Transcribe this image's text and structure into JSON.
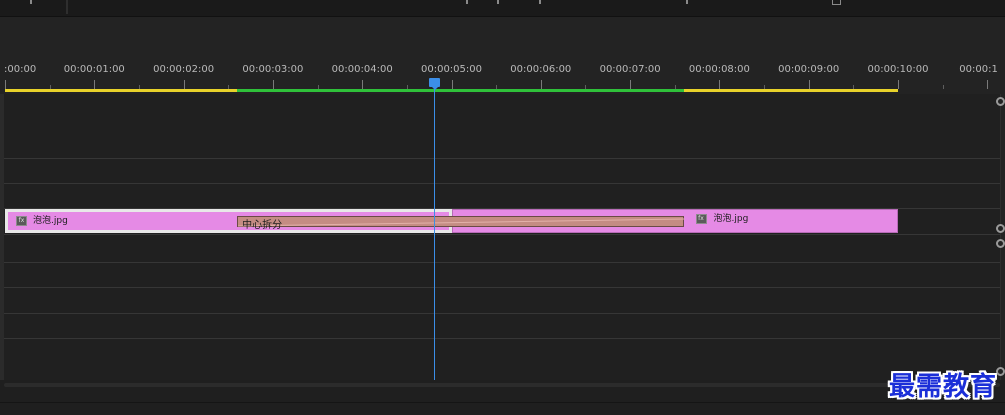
{
  "ruler": {
    "timecodes": [
      ":00:00",
      "00:00:01:00",
      "00:00:02:00",
      "00:00:03:00",
      "00:00:04:00",
      "00:00:05:00",
      "00:00:06:00",
      "00:00:07:00",
      "00:00:08:00",
      "00:00:09:00",
      "00:00:10:00",
      "00:00:1"
    ]
  },
  "colors": {
    "clip": "#e58ae5",
    "transition": "#c48c83",
    "playhead": "#3b8ee8",
    "work_area_yellow": "#e8d22a",
    "work_area_green": "#2fc13a"
  },
  "playhead": {
    "time_seconds": 4.8
  },
  "clips": [
    {
      "name": "泡泡.jpg",
      "start_seconds": 0,
      "end_seconds": 5.0,
      "selected": true
    },
    {
      "name": "泡泡.jpg",
      "start_seconds": 5.0,
      "end_seconds": 10.0,
      "selected": false
    }
  ],
  "transition": {
    "label": "中心拆分",
    "start_seconds": 2.6,
    "end_seconds": 7.6
  },
  "work_area": {
    "segments": [
      {
        "start_seconds": 0,
        "end_seconds": 2.6,
        "color": "#e8d22a"
      },
      {
        "start_seconds": 2.6,
        "end_seconds": 7.6,
        "color": "#2fc13a"
      },
      {
        "start_seconds": 7.6,
        "end_seconds": 10.0,
        "color": "#e8d22a"
      }
    ]
  },
  "icons": {
    "effect_badge": "fx-badge-icon"
  },
  "watermark": {
    "text": "最需教育"
  }
}
